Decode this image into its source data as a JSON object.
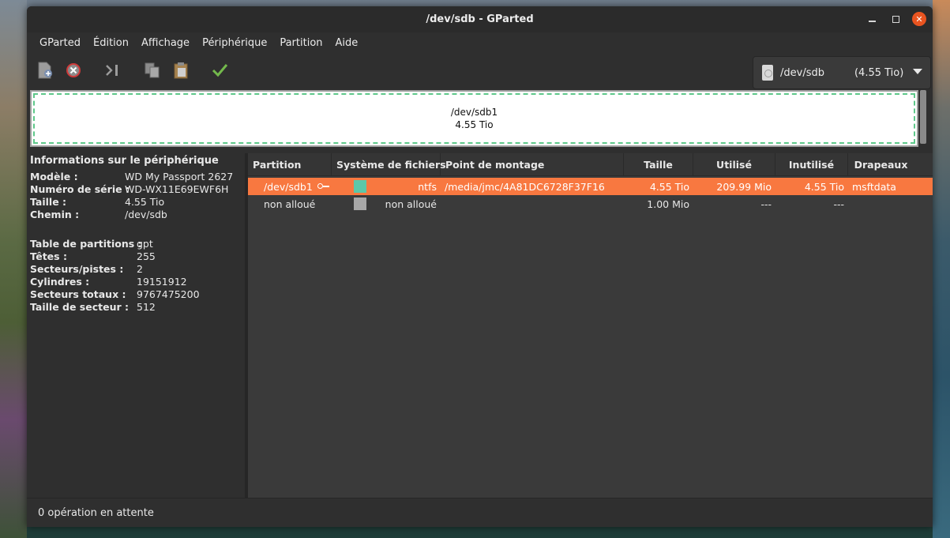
{
  "window": {
    "title": "/dev/sdb - GParted"
  },
  "menu": [
    "GParted",
    "Édition",
    "Affichage",
    "Périphérique",
    "Partition",
    "Aide"
  ],
  "toolbar": {
    "buttons": [
      "new-partition-icon",
      "delete-icon",
      "resize-move-icon",
      "copy-icon",
      "paste-icon",
      "apply-icon"
    ]
  },
  "device_selector": {
    "path": "/dev/sdb",
    "size": "(4.55 Tio)"
  },
  "disk_map": {
    "partition": "/dev/sdb1",
    "size": "4.55 Tio",
    "fs_color": "#5ec88a"
  },
  "info": {
    "title": "Informations sur le périphérique",
    "model_label": "Modèle :",
    "model": "WD My Passport 2627",
    "serial_label": "Numéro de série :",
    "serial": "WD-WX11E69EWF6H",
    "size_label": "Taille :",
    "size": "4.55 Tio",
    "path_label": "Chemin :",
    "path": "/dev/sdb",
    "table_label": "Table de partitions :",
    "table": "gpt",
    "heads_label": "Têtes :",
    "heads": "255",
    "sectors_label": "Secteurs/pistes :",
    "sectors": "2",
    "cyl_label": "Cylindres :",
    "cyl": "19151912",
    "total_label": "Secteurs totaux :",
    "total": "9767475200",
    "sector_size_label": "Taille de secteur :",
    "sector_size": "512"
  },
  "table": {
    "headers": [
      "Partition",
      "Système de fichiers",
      "Point de montage",
      "Taille",
      "Utilisé",
      "Inutilisé",
      "Drapeaux"
    ],
    "rows": [
      {
        "partition": "/dev/sdb1",
        "fs": "ntfs",
        "fs_color": "#5cc8a8",
        "mount": "/media/jmc/4A81DC6728F37F16",
        "size": "4.55 Tio",
        "used": "209.99 Mio",
        "unused": "4.55 Tio",
        "flags": "msftdata"
      },
      {
        "partition": "non alloué",
        "fs": "non alloué",
        "fs_color": "#a8a8a8",
        "mount": "",
        "size": "1.00 Mio",
        "used": "---",
        "unused": "---",
        "flags": ""
      }
    ]
  },
  "status": {
    "text": "0 opération en attente"
  },
  "colors": {
    "selected_row": "#f87840",
    "close_button": "#e95420",
    "apply_check": "#73b94c"
  }
}
